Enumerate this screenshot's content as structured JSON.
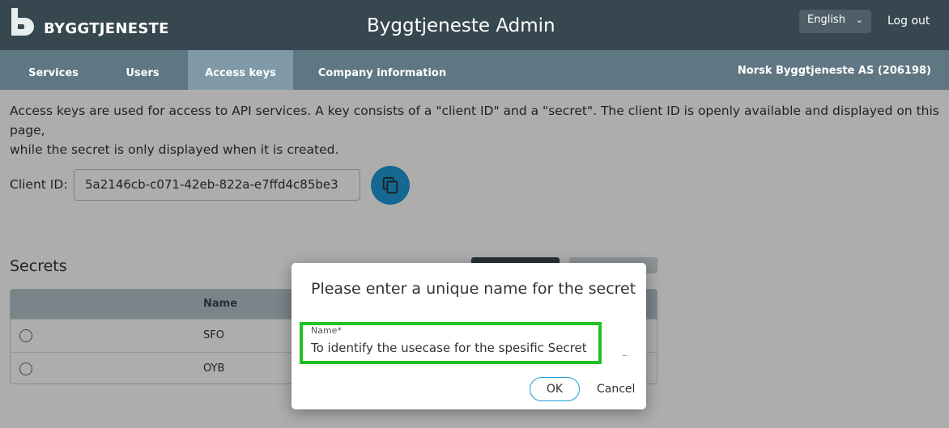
{
  "header": {
    "logo_text": "BYGGTJENESTE",
    "app_title": "Byggtjeneste Admin",
    "language": "English",
    "logout_label": "Log out"
  },
  "nav": {
    "tabs": [
      {
        "label": "Services",
        "active": false
      },
      {
        "label": "Users",
        "active": false
      },
      {
        "label": "Access keys",
        "active": true
      },
      {
        "label": "Company information",
        "active": false
      }
    ],
    "company": "Norsk Byggtjeneste AS (206198)"
  },
  "main": {
    "intro_line1": "Access keys are used for access to API services. A key consists of a \"client ID\" and a \"secret\". The client ID is openly available and displayed on this page,",
    "intro_line2": "while the secret is only displayed when it is created.",
    "client_id_label": "Client ID:",
    "client_id_value": "5a2146cb-c071-42eb-822a-e7ffd4c85be3",
    "secrets_title": "Secrets",
    "table": {
      "headers": [
        "Name"
      ],
      "rows": [
        {
          "name": "SFO"
        },
        {
          "name": "OYB"
        }
      ]
    }
  },
  "dialog": {
    "title": "Please enter a unique name for the secret",
    "field_label": "Name*",
    "field_value": "To identify the usecase for the spesific Secret",
    "ok_label": "OK",
    "cancel_label": "Cancel"
  },
  "colors": {
    "header_bg": "#37474f",
    "nav_bg": "#5f7782",
    "accent": "#1e9ad6",
    "highlight": "#1fc21f"
  }
}
